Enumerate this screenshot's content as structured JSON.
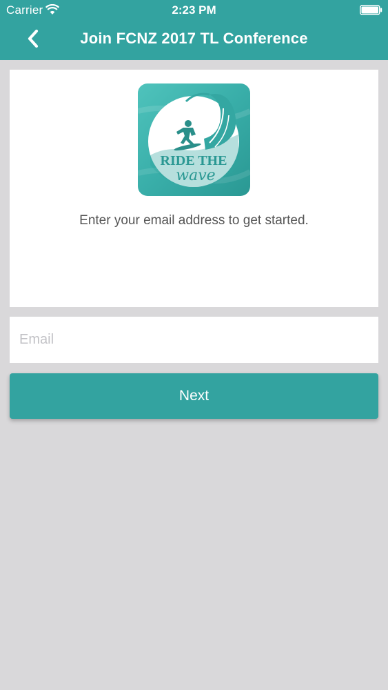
{
  "status_bar": {
    "carrier": "Carrier",
    "time": "2:23 PM",
    "wifi_icon": "wifi-icon",
    "battery_icon": "battery-icon"
  },
  "nav": {
    "back_icon": "chevron-left-icon",
    "title": "Join FCNZ 2017 TL Conference"
  },
  "logo": {
    "text_line1": "RIDE THE",
    "text_line2": "wave"
  },
  "card": {
    "prompt": "Enter your email address to get started."
  },
  "email": {
    "placeholder": "Email",
    "value": ""
  },
  "next_button": {
    "label": "Next"
  },
  "colors": {
    "accent": "#33a3a0",
    "background": "#d9d8da",
    "card": "#ffffff",
    "prompt_text": "#555555",
    "placeholder": "#c2c2c6"
  }
}
